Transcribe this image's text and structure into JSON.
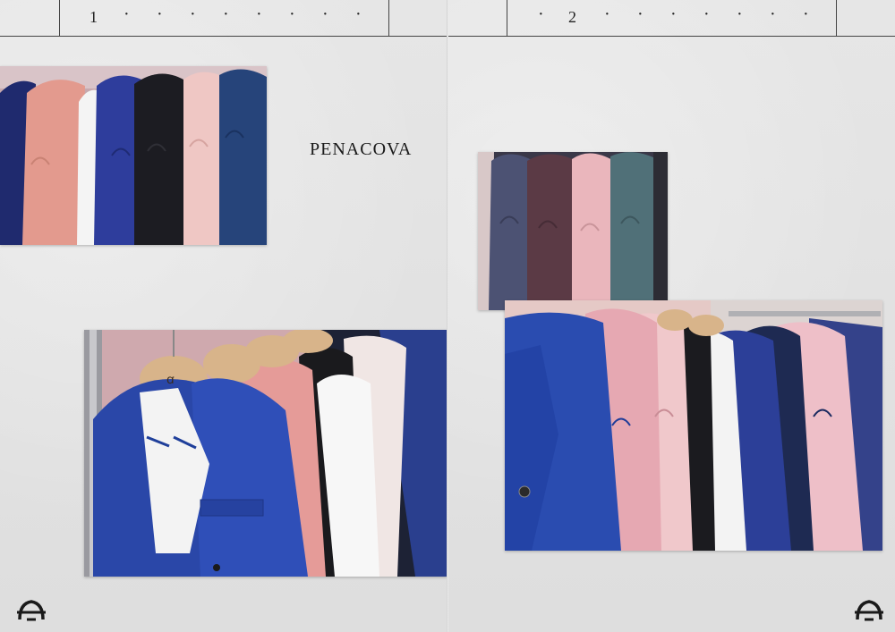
{
  "left_page": {
    "page_number": "1",
    "title": "PENACOVA",
    "logo_icon": "brand-monogram-icon"
  },
  "right_page": {
    "page_number": "2",
    "logo_icon": "brand-monogram-icon"
  },
  "colors": {
    "paper": "#e3e3e3",
    "rule": "#444444",
    "royal_blue": "#2a47a8",
    "navy": "#1f2a55",
    "pink": "#e6a0a0",
    "white": "#f2f2f2",
    "black": "#1b1b1e",
    "wall_pink": "#c9a3a8",
    "hanger_wood": "#d8b48a"
  }
}
